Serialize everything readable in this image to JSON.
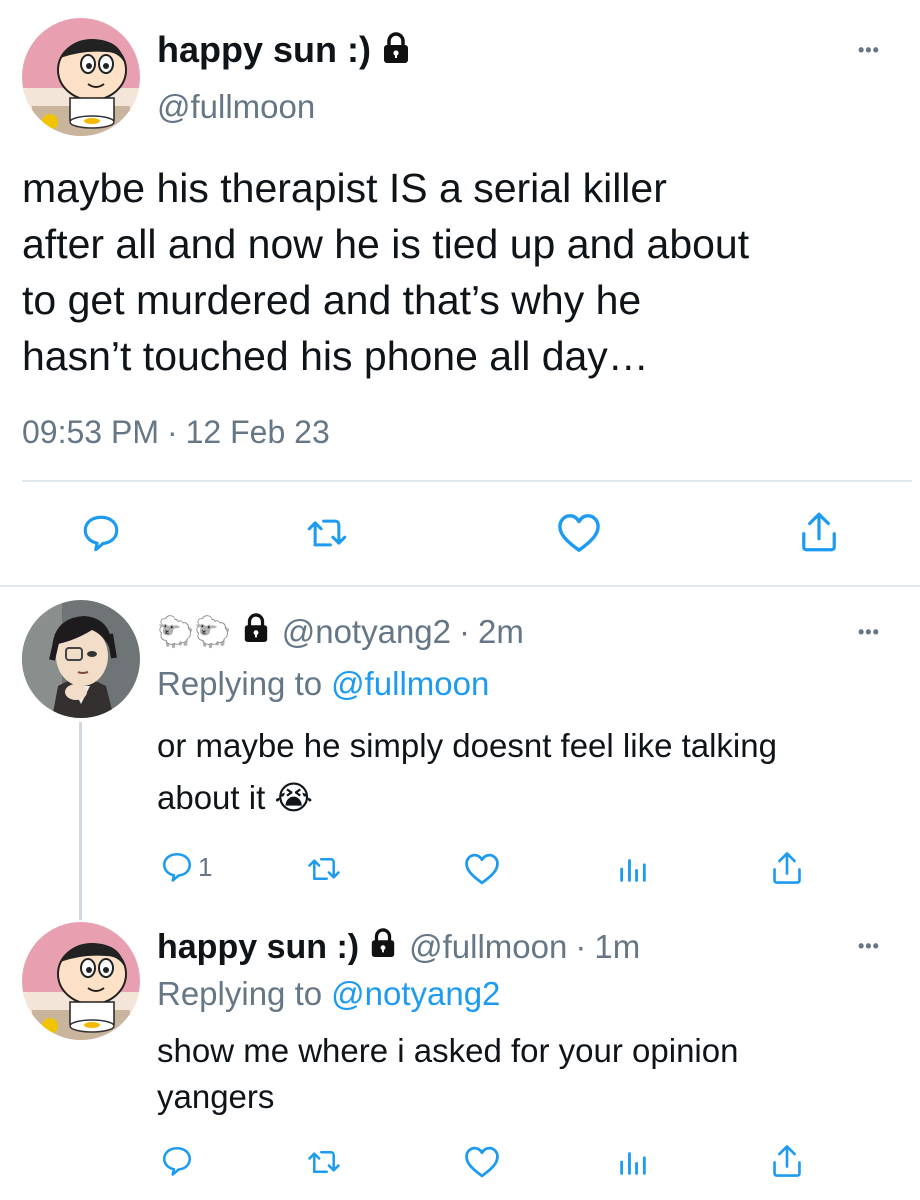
{
  "main_tweet": {
    "author": {
      "name": "happy sun :)",
      "handle": "@fullmoon"
    },
    "text": "maybe his therapist IS a serial killer after all and now he is tied up and about to get murdered and that’s why he hasn’t touched his phone all day…",
    "lines": [
      "maybe his therapist IS a serial killer",
      "after all and now he is tied up and about",
      "to get murdered and that’s why he",
      "hasn’t touched his phone all day…"
    ],
    "time": "09:53 PM",
    "date": "12 Feb 23",
    "actions": [
      "reply-icon",
      "retweet-icon",
      "like-icon",
      "share-icon"
    ]
  },
  "replies": [
    {
      "name_emoji": "🐑🐑",
      "handle": "@notyang2",
      "age": "2m",
      "replying_label": "Replying to",
      "replying_to": "@fullmoon",
      "lines": [
        "or maybe he simply doesnt feel like talking",
        "about it 😭"
      ],
      "reply_count": "1"
    },
    {
      "name": "happy sun :)",
      "handle": "@fullmoon",
      "age": "1m",
      "replying_label": "Replying to",
      "replying_to": "@notyang2",
      "lines": [
        "show me where i asked for your opinion",
        "yangers"
      ]
    }
  ],
  "separator": "·",
  "more_label": "•••",
  "colors": {
    "link": "#1d9bf0",
    "muted": "#657786",
    "divider": "#e1e8ed",
    "icon": "#1d9bf0"
  }
}
